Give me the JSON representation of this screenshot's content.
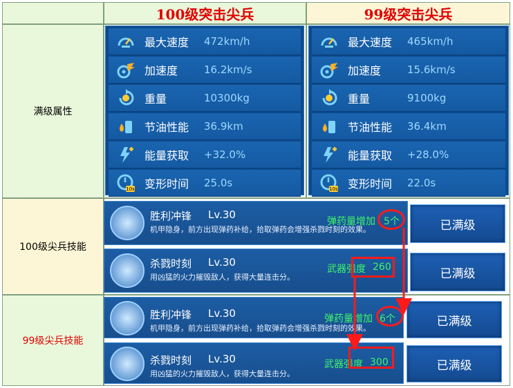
{
  "headers": {
    "left": "100级突击尖兵",
    "right": "99级突击尖兵"
  },
  "row_labels": {
    "stats": "满级属性",
    "skills_100": "100级尖兵技能",
    "skills_99": "99级尖兵技能"
  },
  "stats_100": [
    {
      "icon": "speedometer-icon",
      "name": "最大速度",
      "value": "472km/h"
    },
    {
      "icon": "acceleration-icon",
      "name": "加速度",
      "value": "16.2km/s"
    },
    {
      "icon": "weight-icon",
      "name": "重量",
      "value": "10300kg"
    },
    {
      "icon": "fuel-icon",
      "name": "节油性能",
      "value": "36.9km"
    },
    {
      "icon": "energy-icon",
      "name": "能量获取",
      "value": "+32.0%"
    },
    {
      "icon": "timer-icon",
      "name": "变形时间",
      "value": "25.0s"
    }
  ],
  "stats_99": [
    {
      "icon": "speedometer-icon",
      "name": "最大速度",
      "value": "465km/h"
    },
    {
      "icon": "acceleration-icon",
      "name": "加速度",
      "value": "15.6km/s"
    },
    {
      "icon": "weight-icon",
      "name": "重量",
      "value": "9100kg"
    },
    {
      "icon": "fuel-icon",
      "name": "节油性能",
      "value": "36.4km"
    },
    {
      "icon": "energy-icon",
      "name": "能量获取",
      "value": "+28.0%"
    },
    {
      "icon": "timer-icon",
      "name": "变形时间",
      "value": "22.0s"
    }
  ],
  "skills_100": [
    {
      "name": "胜利冲锋",
      "level": "Lv.30",
      "desc": "机甲隐身，前方出现弹药补给，拾取弹药会增强杀戮时刻的效果。",
      "stat_label": "弹药量增加",
      "stat_value": "5个",
      "button": "已满级"
    },
    {
      "name": "杀戮时刻",
      "level": "Lv.30",
      "desc": "用凶猛的火力摧毁敌人，获得大量连击分。",
      "stat_label": "武器强度",
      "stat_value": "260",
      "button": "已满级"
    }
  ],
  "skills_99": [
    {
      "name": "胜利冲锋",
      "level": "Lv.30",
      "desc": "机甲隐身，前方出现弹药补给，拾取弹药会增强杀戮时刻的效果。",
      "stat_label": "弹药量增加",
      "stat_value": "6个",
      "button": "已满级"
    },
    {
      "name": "杀戮时刻",
      "level": "Lv.30",
      "desc": "用凶猛的火力摧毁敌人，获得大量连击分。",
      "stat_label": "武器强度",
      "stat_value": "300",
      "button": "已满级"
    }
  ],
  "colors": {
    "header_text": "#e00000",
    "highlight": "#ff1a1a",
    "stat_green": "#3ff56a"
  }
}
